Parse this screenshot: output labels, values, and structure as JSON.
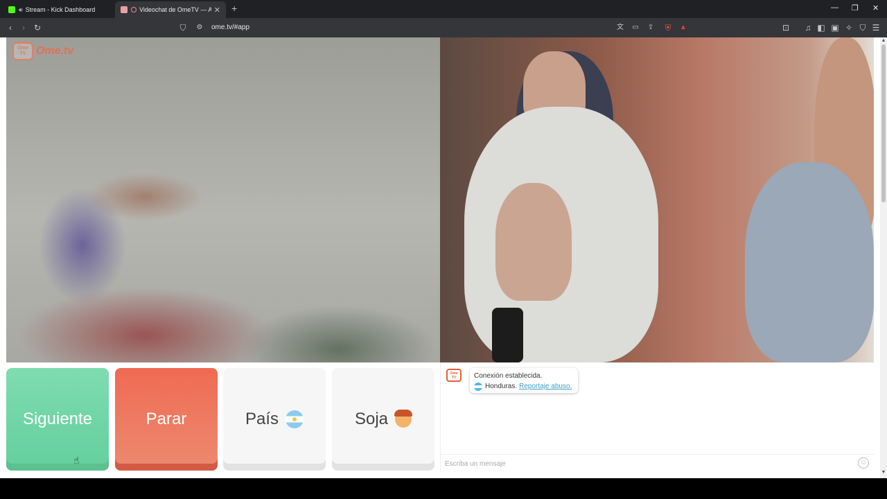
{
  "browser": {
    "tabs": [
      {
        "title": "Stream - Kick Dashboard"
      },
      {
        "title": "Videochat de OmeTV — Alte"
      }
    ],
    "new_tab": "+",
    "url": "ome.tv/#app",
    "window_controls": {
      "minimize": "—",
      "restore": "❐",
      "close": "✕"
    }
  },
  "site": {
    "logo_text": "Ome.tv",
    "logo_badge": "Ome\nTV"
  },
  "controls": {
    "next_label": "Siguiente",
    "stop_label": "Parar",
    "country_label": "País",
    "gender_label": "Soja"
  },
  "chat": {
    "message_line1": "Conexión establecida.",
    "country_name": "Honduras.",
    "report_link": "Reportaje abuso.",
    "input_placeholder": "Escriba un mensaje",
    "input_value": ""
  },
  "colors": {
    "next": "#63cf9d",
    "stop": "#ec6b52",
    "link": "#3aa0c8"
  }
}
